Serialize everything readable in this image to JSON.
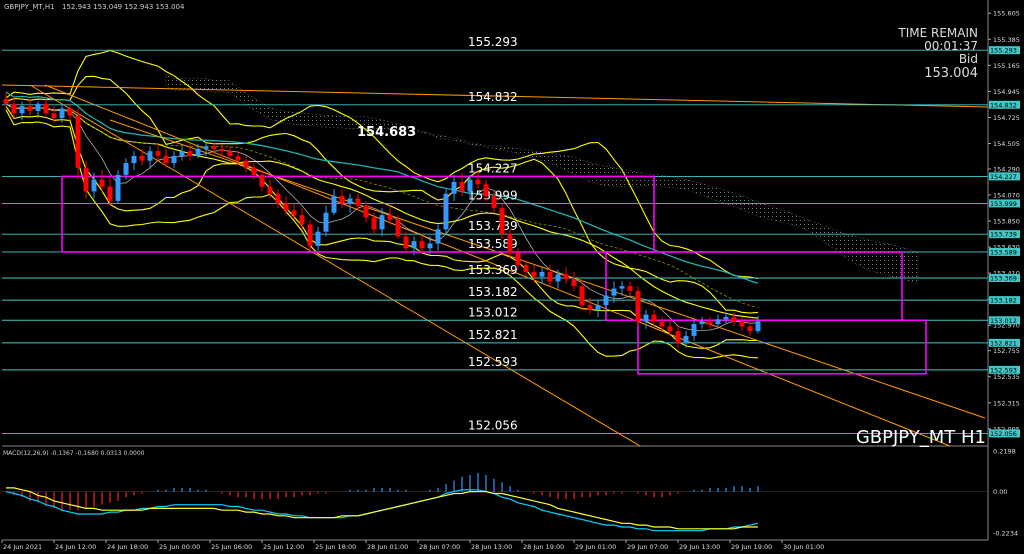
{
  "header": {
    "title": "GBPJPY_MT,H1",
    "quote": "152.943 153.049 152.943 153.004"
  },
  "info": {
    "time_remain_label": "TIME REMAIN",
    "time_remain_value": "00:01:37",
    "bid_label": "Bid",
    "bid_value": "153.004"
  },
  "symbol_watermark": "GBPJPY_MT H1",
  "peak_label": "154.683",
  "macd_title": "MACD(12,26,9) -0.1367 -0.1680 0.0313 0.0000",
  "colors": {
    "background": "#000000",
    "bull_candle": "#3399ff",
    "bear_candle": "#ff0000",
    "level_line": "#40c8c8",
    "box": "#ff00ff",
    "trend": "#ff9900",
    "band": "#ffff00",
    "macd_signal": "#00d2ff",
    "macd_line": "#ffff33"
  },
  "chart_data": [
    {
      "type": "candlestick",
      "title": "GBPJPY_MT,H1",
      "ylim": [
        151.95,
        155.7
      ],
      "price_axis": {
        "ticks": [
          "155.605",
          "155.385",
          "155.165",
          "154.945",
          "154.725",
          "154.505",
          "154.290",
          "154.070",
          "153.850",
          "153.630",
          "153.410",
          "153.190",
          "152.970",
          "152.755",
          "152.535",
          "152.315",
          "152.095"
        ],
        "highlighted": [
          "155.293",
          "154.832",
          "154.227",
          "153.999",
          "153.739",
          "153.589",
          "153.369",
          "153.182",
          "153.012",
          "152.821",
          "152.593",
          "152.056"
        ]
      },
      "levels": [
        {
          "label": "155.293",
          "value": 155.293
        },
        {
          "label": "154.832",
          "value": 154.832
        },
        {
          "label": "154.227",
          "value": 154.227
        },
        {
          "label": "153.999",
          "value": 153.999
        },
        {
          "label": "153.739",
          "value": 153.739
        },
        {
          "label": "153.589",
          "value": 153.589
        },
        {
          "label": "153.369",
          "value": 153.369
        },
        {
          "label": "153.182",
          "value": 153.182
        },
        {
          "label": "153.012",
          "value": 153.012
        },
        {
          "label": "152.821",
          "value": 152.821
        },
        {
          "label": "152.593",
          "value": 152.593
        },
        {
          "label": "152.056",
          "value": 152.056
        }
      ],
      "time_axis": [
        "24 Jun 2021",
        "24 Jun 12:00",
        "24 Jun 18:00",
        "25 Jun 00:00",
        "25 Jun 06:00",
        "25 Jun 12:00",
        "25 Jun 18:00",
        "28 Jun 01:00",
        "28 Jun 07:00",
        "28 Jun 13:00",
        "28 Jun 19:00",
        "29 Jun 01:00",
        "29 Jun 07:00",
        "29 Jun 13:00",
        "29 Jun 19:00",
        "30 Jun 01:00"
      ],
      "candles": [
        {
          "o": 154.88,
          "h": 154.93,
          "l": 154.8,
          "c": 154.84
        },
        {
          "o": 154.84,
          "h": 154.9,
          "l": 154.72,
          "c": 154.76
        },
        {
          "o": 154.76,
          "h": 154.86,
          "l": 154.7,
          "c": 154.82
        },
        {
          "o": 154.82,
          "h": 154.88,
          "l": 154.74,
          "c": 154.78
        },
        {
          "o": 154.78,
          "h": 154.86,
          "l": 154.72,
          "c": 154.84
        },
        {
          "o": 154.84,
          "h": 154.88,
          "l": 154.74,
          "c": 154.76
        },
        {
          "o": 154.76,
          "h": 154.82,
          "l": 154.68,
          "c": 154.72
        },
        {
          "o": 154.72,
          "h": 154.84,
          "l": 154.68,
          "c": 154.8
        },
        {
          "o": 154.8,
          "h": 154.84,
          "l": 154.7,
          "c": 154.74
        },
        {
          "o": 154.74,
          "h": 154.8,
          "l": 154.2,
          "c": 154.3
        },
        {
          "o": 154.3,
          "h": 154.36,
          "l": 154.04,
          "c": 154.1
        },
        {
          "o": 154.1,
          "h": 154.26,
          "l": 154.04,
          "c": 154.2
        },
        {
          "o": 154.2,
          "h": 154.28,
          "l": 154.1,
          "c": 154.14
        },
        {
          "o": 154.14,
          "h": 154.22,
          "l": 153.98,
          "c": 154.02
        },
        {
          "o": 154.02,
          "h": 154.28,
          "l": 154.0,
          "c": 154.24
        },
        {
          "o": 154.24,
          "h": 154.38,
          "l": 154.2,
          "c": 154.34
        },
        {
          "o": 154.34,
          "h": 154.44,
          "l": 154.28,
          "c": 154.4
        },
        {
          "o": 154.4,
          "h": 154.46,
          "l": 154.32,
          "c": 154.36
        },
        {
          "o": 154.36,
          "h": 154.48,
          "l": 154.3,
          "c": 154.44
        },
        {
          "o": 154.44,
          "h": 154.5,
          "l": 154.36,
          "c": 154.4
        },
        {
          "o": 154.4,
          "h": 154.46,
          "l": 154.3,
          "c": 154.34
        },
        {
          "o": 154.34,
          "h": 154.44,
          "l": 154.3,
          "c": 154.4
        },
        {
          "o": 154.4,
          "h": 154.48,
          "l": 154.36,
          "c": 154.44
        },
        {
          "o": 154.44,
          "h": 154.5,
          "l": 154.36,
          "c": 154.4
        },
        {
          "o": 154.4,
          "h": 154.5,
          "l": 154.38,
          "c": 154.46
        },
        {
          "o": 154.46,
          "h": 154.52,
          "l": 154.4,
          "c": 154.48
        },
        {
          "o": 154.48,
          "h": 154.52,
          "l": 154.42,
          "c": 154.46
        },
        {
          "o": 154.46,
          "h": 154.5,
          "l": 154.38,
          "c": 154.44
        },
        {
          "o": 154.44,
          "h": 154.48,
          "l": 154.36,
          "c": 154.4
        },
        {
          "o": 154.4,
          "h": 154.44,
          "l": 154.32,
          "c": 154.36
        },
        {
          "o": 154.36,
          "h": 154.4,
          "l": 154.26,
          "c": 154.3
        },
        {
          "o": 154.3,
          "h": 154.34,
          "l": 154.2,
          "c": 154.24
        },
        {
          "o": 154.24,
          "h": 154.28,
          "l": 154.1,
          "c": 154.14
        },
        {
          "o": 154.14,
          "h": 154.2,
          "l": 154.04,
          "c": 154.08
        },
        {
          "o": 154.08,
          "h": 154.12,
          "l": 153.96,
          "c": 154.0
        },
        {
          "o": 154.0,
          "h": 154.06,
          "l": 153.9,
          "c": 153.94
        },
        {
          "o": 153.94,
          "h": 154.0,
          "l": 153.86,
          "c": 153.9
        },
        {
          "o": 153.9,
          "h": 153.96,
          "l": 153.78,
          "c": 153.82
        },
        {
          "o": 153.82,
          "h": 153.86,
          "l": 153.6,
          "c": 153.64
        },
        {
          "o": 153.64,
          "h": 153.8,
          "l": 153.6,
          "c": 153.76
        },
        {
          "o": 153.76,
          "h": 153.98,
          "l": 153.72,
          "c": 153.92
        },
        {
          "o": 153.92,
          "h": 154.12,
          "l": 153.9,
          "c": 154.06
        },
        {
          "o": 154.06,
          "h": 154.12,
          "l": 153.96,
          "c": 154.0
        },
        {
          "o": 154.0,
          "h": 154.08,
          "l": 153.92,
          "c": 154.04
        },
        {
          "o": 154.04,
          "h": 154.08,
          "l": 153.94,
          "c": 153.98
        },
        {
          "o": 153.98,
          "h": 154.02,
          "l": 153.84,
          "c": 153.88
        },
        {
          "o": 153.88,
          "h": 153.92,
          "l": 153.74,
          "c": 153.78
        },
        {
          "o": 153.78,
          "h": 153.96,
          "l": 153.72,
          "c": 153.9
        },
        {
          "o": 153.9,
          "h": 153.98,
          "l": 153.82,
          "c": 153.86
        },
        {
          "o": 153.86,
          "h": 153.9,
          "l": 153.7,
          "c": 153.72
        },
        {
          "o": 153.72,
          "h": 153.76,
          "l": 153.58,
          "c": 153.62
        },
        {
          "o": 153.62,
          "h": 153.72,
          "l": 153.56,
          "c": 153.68
        },
        {
          "o": 153.68,
          "h": 153.74,
          "l": 153.58,
          "c": 153.62
        },
        {
          "o": 153.62,
          "h": 153.72,
          "l": 153.56,
          "c": 153.66
        },
        {
          "o": 153.66,
          "h": 153.82,
          "l": 153.6,
          "c": 153.78
        },
        {
          "o": 153.78,
          "h": 154.12,
          "l": 153.74,
          "c": 154.08
        },
        {
          "o": 154.08,
          "h": 154.24,
          "l": 154.02,
          "c": 154.18
        },
        {
          "o": 154.18,
          "h": 154.26,
          "l": 154.06,
          "c": 154.1
        },
        {
          "o": 154.1,
          "h": 154.24,
          "l": 154.04,
          "c": 154.2
        },
        {
          "o": 154.2,
          "h": 154.28,
          "l": 154.12,
          "c": 154.16
        },
        {
          "o": 154.16,
          "h": 154.2,
          "l": 154.02,
          "c": 154.06
        },
        {
          "o": 154.06,
          "h": 154.1,
          "l": 153.92,
          "c": 153.96
        },
        {
          "o": 153.96,
          "h": 154.0,
          "l": 153.7,
          "c": 153.74
        },
        {
          "o": 153.74,
          "h": 153.78,
          "l": 153.54,
          "c": 153.58
        },
        {
          "o": 153.58,
          "h": 153.62,
          "l": 153.44,
          "c": 153.48
        },
        {
          "o": 153.48,
          "h": 153.52,
          "l": 153.38,
          "c": 153.42
        },
        {
          "o": 153.42,
          "h": 153.48,
          "l": 153.34,
          "c": 153.38
        },
        {
          "o": 153.38,
          "h": 153.46,
          "l": 153.32,
          "c": 153.42
        },
        {
          "o": 153.42,
          "h": 153.48,
          "l": 153.3,
          "c": 153.34
        },
        {
          "o": 153.34,
          "h": 153.44,
          "l": 153.28,
          "c": 153.4
        },
        {
          "o": 153.4,
          "h": 153.46,
          "l": 153.32,
          "c": 153.36
        },
        {
          "o": 153.36,
          "h": 153.42,
          "l": 153.26,
          "c": 153.3
        },
        {
          "o": 153.3,
          "h": 153.36,
          "l": 153.1,
          "c": 153.14
        },
        {
          "o": 153.14,
          "h": 153.2,
          "l": 153.06,
          "c": 153.1
        },
        {
          "o": 153.1,
          "h": 153.18,
          "l": 153.04,
          "c": 153.14
        },
        {
          "o": 153.14,
          "h": 153.26,
          "l": 153.08,
          "c": 153.22
        },
        {
          "o": 153.22,
          "h": 153.34,
          "l": 153.16,
          "c": 153.28
        },
        {
          "o": 153.28,
          "h": 153.34,
          "l": 153.22,
          "c": 153.3
        },
        {
          "o": 153.3,
          "h": 153.34,
          "l": 153.22,
          "c": 153.26
        },
        {
          "o": 153.26,
          "h": 153.3,
          "l": 152.96,
          "c": 153.0
        },
        {
          "o": 153.0,
          "h": 153.1,
          "l": 152.94,
          "c": 153.06
        },
        {
          "o": 153.06,
          "h": 153.1,
          "l": 152.96,
          "c": 153.0
        },
        {
          "o": 153.0,
          "h": 153.04,
          "l": 152.92,
          "c": 152.96
        },
        {
          "o": 152.96,
          "h": 153.02,
          "l": 152.88,
          "c": 152.92
        },
        {
          "o": 152.92,
          "h": 152.98,
          "l": 152.78,
          "c": 152.82
        },
        {
          "o": 152.82,
          "h": 152.92,
          "l": 152.78,
          "c": 152.88
        },
        {
          "o": 152.88,
          "h": 153.02,
          "l": 152.84,
          "c": 152.98
        },
        {
          "o": 152.98,
          "h": 153.04,
          "l": 152.94,
          "c": 153.0
        },
        {
          "o": 153.0,
          "h": 153.04,
          "l": 152.94,
          "c": 152.98
        },
        {
          "o": 152.98,
          "h": 153.06,
          "l": 152.94,
          "c": 153.02
        },
        {
          "o": 153.02,
          "h": 153.08,
          "l": 152.98,
          "c": 153.04
        },
        {
          "o": 153.04,
          "h": 153.08,
          "l": 152.96,
          "c": 153.0
        },
        {
          "o": 153.0,
          "h": 153.04,
          "l": 152.92,
          "c": 152.96
        },
        {
          "o": 152.96,
          "h": 153.0,
          "l": 152.88,
          "c": 152.92
        },
        {
          "o": 152.92,
          "h": 153.05,
          "l": 152.9,
          "c": 153.004
        }
      ],
      "boxes": [
        {
          "t0": 7,
          "t1": 81,
          "top": 154.227,
          "bottom": 153.589
        },
        {
          "t0": 75,
          "t1": 112,
          "top": 153.589,
          "bottom": 153.012
        },
        {
          "t0": 79,
          "t1": 115,
          "top": 153.012,
          "bottom": 152.56
        }
      ]
    },
    {
      "type": "bar",
      "title": "MACD(12,26,9) -0.1367 -0.1680 0.0313 0.0000",
      "ylim": [
        -0.26,
        0.24
      ],
      "axis_ticks": [
        "0.2198",
        "0.00",
        "-0.2234"
      ],
      "histogram": [
        0.0,
        -0.02,
        -0.03,
        -0.05,
        -0.06,
        -0.08,
        -0.09,
        -0.1,
        -0.1,
        -0.1,
        -0.09,
        -0.08,
        -0.07,
        -0.06,
        -0.05,
        -0.03,
        -0.02,
        -0.01,
        0.0,
        0.01,
        0.01,
        0.02,
        0.02,
        0.02,
        0.01,
        0.01,
        0.0,
        -0.01,
        -0.02,
        -0.03,
        -0.03,
        -0.04,
        -0.04,
        -0.04,
        -0.04,
        -0.03,
        -0.03,
        -0.02,
        -0.02,
        -0.01,
        -0.01,
        0.0,
        0.0,
        0.01,
        0.01,
        0.01,
        0.02,
        0.02,
        0.02,
        0.01,
        0.01,
        0.0,
        0.0,
        0.01,
        0.02,
        0.04,
        0.06,
        0.08,
        0.09,
        0.1,
        0.09,
        0.07,
        0.05,
        0.03,
        0.01,
        0.0,
        -0.01,
        -0.02,
        -0.03,
        -0.04,
        -0.04,
        -0.04,
        -0.03,
        -0.03,
        -0.02,
        -0.02,
        -0.01,
        -0.01,
        0.0,
        -0.01,
        -0.02,
        -0.03,
        -0.03,
        -0.02,
        -0.01,
        0.0,
        0.01,
        0.01,
        0.02,
        0.02,
        0.02,
        0.03,
        0.03,
        0.02,
        0.03
      ],
      "signal": [
        0.0,
        -0.01,
        -0.02,
        -0.04,
        -0.05,
        -0.07,
        -0.08,
        -0.1,
        -0.11,
        -0.12,
        -0.12,
        -0.12,
        -0.12,
        -0.11,
        -0.11,
        -0.1,
        -0.1,
        -0.09,
        -0.09,
        -0.08,
        -0.08,
        -0.07,
        -0.07,
        -0.07,
        -0.07,
        -0.07,
        -0.07,
        -0.07,
        -0.08,
        -0.08,
        -0.09,
        -0.1,
        -0.1,
        -0.11,
        -0.12,
        -0.12,
        -0.13,
        -0.13,
        -0.14,
        -0.14,
        -0.14,
        -0.14,
        -0.14,
        -0.13,
        -0.13,
        -0.12,
        -0.11,
        -0.1,
        -0.09,
        -0.08,
        -0.07,
        -0.06,
        -0.05,
        -0.04,
        -0.03,
        -0.01,
        0.0,
        0.01,
        0.01,
        0.01,
        0.0,
        -0.01,
        -0.03,
        -0.04,
        -0.06,
        -0.07,
        -0.08,
        -0.1,
        -0.11,
        -0.12,
        -0.13,
        -0.14,
        -0.15,
        -0.16,
        -0.17,
        -0.18,
        -0.18,
        -0.19,
        -0.19,
        -0.2,
        -0.2,
        -0.21,
        -0.21,
        -0.21,
        -0.21,
        -0.21,
        -0.21,
        -0.21,
        -0.2,
        -0.2,
        -0.2,
        -0.19,
        -0.19,
        -0.18,
        -0.17
      ],
      "macd": [
        0.02,
        0.02,
        0.01,
        0.0,
        -0.02,
        -0.03,
        -0.05,
        -0.06,
        -0.07,
        -0.08,
        -0.09,
        -0.09,
        -0.1,
        -0.1,
        -0.1,
        -0.1,
        -0.1,
        -0.1,
        -0.09,
        -0.09,
        -0.09,
        -0.09,
        -0.09,
        -0.09,
        -0.09,
        -0.09,
        -0.09,
        -0.1,
        -0.1,
        -0.1,
        -0.11,
        -0.11,
        -0.12,
        -0.12,
        -0.13,
        -0.13,
        -0.14,
        -0.14,
        -0.14,
        -0.14,
        -0.14,
        -0.14,
        -0.13,
        -0.13,
        -0.13,
        -0.12,
        -0.11,
        -0.1,
        -0.09,
        -0.08,
        -0.07,
        -0.06,
        -0.05,
        -0.04,
        -0.03,
        -0.02,
        -0.01,
        -0.01,
        0.0,
        0.0,
        0.0,
        -0.01,
        -0.01,
        -0.02,
        -0.03,
        -0.04,
        -0.05,
        -0.06,
        -0.07,
        -0.09,
        -0.1,
        -0.11,
        -0.12,
        -0.13,
        -0.14,
        -0.15,
        -0.16,
        -0.17,
        -0.17,
        -0.18,
        -0.18,
        -0.19,
        -0.19,
        -0.19,
        -0.2,
        -0.2,
        -0.2,
        -0.2,
        -0.2,
        -0.2,
        -0.2,
        -0.2,
        -0.19,
        -0.19,
        -0.19
      ]
    }
  ]
}
